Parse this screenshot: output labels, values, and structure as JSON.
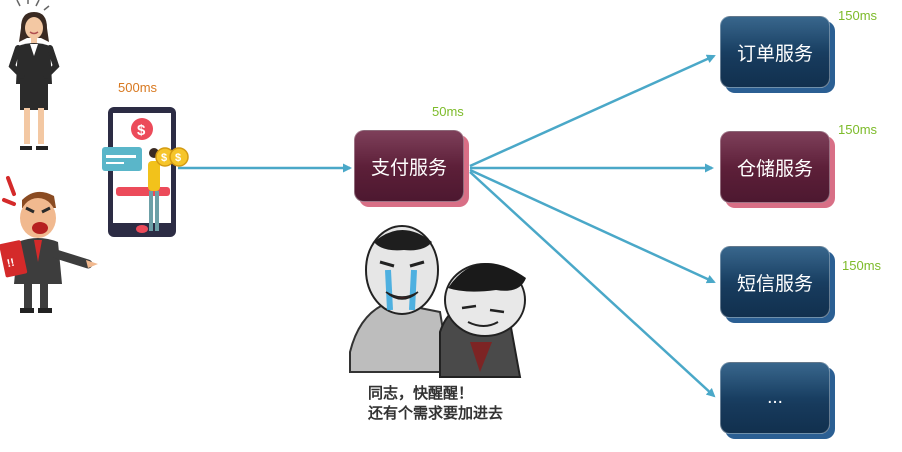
{
  "colors": {
    "arrow": "#4aa8c8",
    "service_blue": "#173a5c",
    "service_red": "#5a1e37",
    "latency_green": "#7dbb2a",
    "latency_orange": "#d87921"
  },
  "client": {
    "latency": "500ms"
  },
  "payment": {
    "label": "支付服务",
    "latency": "50ms"
  },
  "services": [
    {
      "label": "订单服务",
      "latency": "150ms"
    },
    {
      "label": "仓储服务",
      "latency": "150ms"
    },
    {
      "label": "短信服务",
      "latency": "150ms"
    },
    {
      "label": "...",
      "latency": ""
    }
  ],
  "meme": {
    "line1": "同志，快醒醒！",
    "line2": "还有个需求要加进去"
  },
  "icons": [
    "businesswoman-icon",
    "angry-boss-icon",
    "phone-payment-icon",
    "dollar-coin-icon",
    "crying-meme-icon"
  ]
}
